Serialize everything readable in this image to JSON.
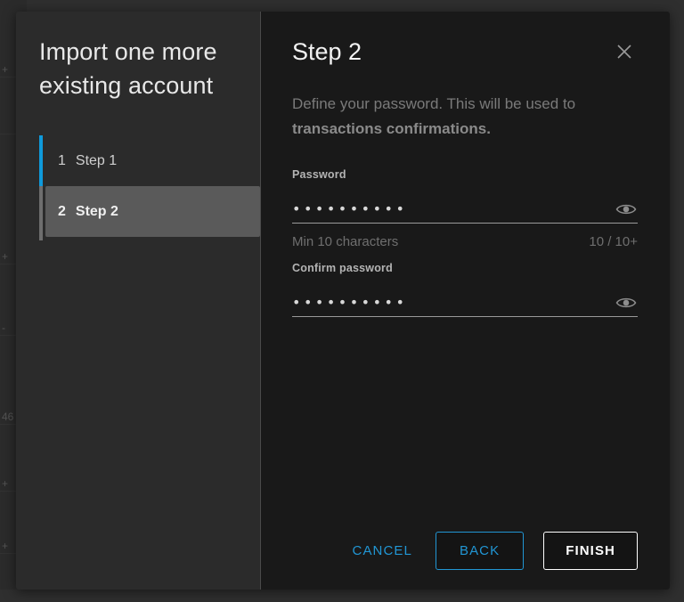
{
  "modal": {
    "title": "Import one more\nexisting account",
    "stepper": {
      "steps": [
        {
          "number": "1",
          "label": "Step 1",
          "active": false
        },
        {
          "number": "2",
          "label": "Step 2",
          "active": true
        }
      ]
    }
  },
  "panel": {
    "step_title": "Step 2",
    "close_icon": "close-icon",
    "description_plain": "Define your password. This will be used to ",
    "description_strong": "transactions confirmations."
  },
  "form": {
    "password": {
      "label": "Password",
      "value": "••••••••••",
      "toggle_icon": "eye-icon",
      "hint": "Min 10 characters",
      "counter": "10 / 10+"
    },
    "confirm_password": {
      "label": "Confirm password",
      "value": "••••••••••",
      "toggle_icon": "eye-icon"
    }
  },
  "footer": {
    "cancel_label": "CANCEL",
    "back_label": "BACK",
    "finish_label": "FINISH"
  },
  "colors": {
    "accent_blue": "#2196d4",
    "stepper_active": "#0f9adb",
    "panel_left_bg": "#2b2b2b",
    "panel_right_bg": "#191919",
    "step_active_bg": "#5a5a5a"
  },
  "background": {
    "rows": [
      "+",
      "",
      "+",
      "-",
      "46",
      "+",
      "+"
    ]
  }
}
